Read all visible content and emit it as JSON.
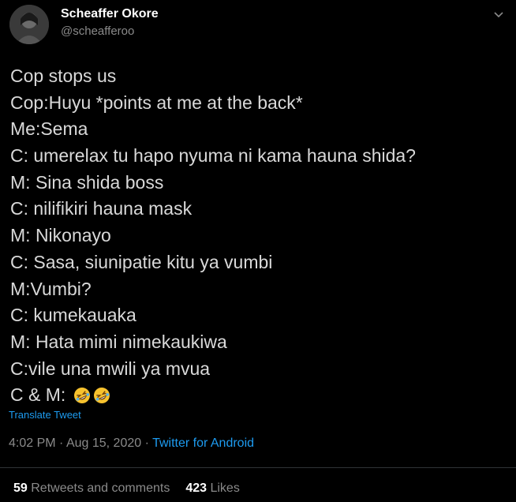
{
  "author": {
    "name": "Scheaffer Okore",
    "handle": "@scheafferoo"
  },
  "tweet": {
    "lines": [
      "Cop stops us",
      "Cop:Huyu *points at me at the back*",
      "Me:Sema",
      "C: umerelax tu hapo nyuma ni kama hauna shida?",
      "M: Sina shida boss",
      "C: nilifikiri hauna mask",
      "M: Nikonayo",
      "C: Sasa, siunipatie kitu ya vumbi",
      "M:Vumbi?",
      "C: kumekauaka",
      "M: Hata mimi nimekaukiwa",
      "C:vile una mwili ya mvua",
      "C & M: "
    ],
    "emojis": [
      "rolling-on-floor-laughing",
      "rolling-on-floor-laughing"
    ],
    "translate_label": "Translate Tweet"
  },
  "meta": {
    "time": "4:02 PM",
    "separator": " · ",
    "date": "Aug 15, 2020",
    "separator2": " · ",
    "source": "Twitter for Android"
  },
  "stats": {
    "retweets_count": "59",
    "retweets_label": " Retweets and comments",
    "likes_count": "423",
    "likes_label": " Likes"
  },
  "colors": {
    "background": "#000000",
    "text": "#d9d9d9",
    "secondary": "#8a8a8a",
    "link": "#1d9bf0"
  }
}
